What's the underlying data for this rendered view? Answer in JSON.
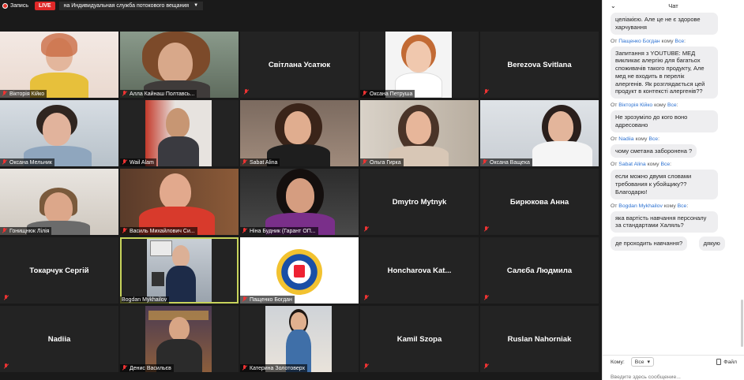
{
  "topbar": {
    "record_label": "Запись",
    "live_label": "LIVE",
    "live_target": "на Индивидуальная служба потокового вещания"
  },
  "tiles": {
    "t1": "Вікторія Кійко",
    "t2": "Алла Кайнаш Полтавсь...",
    "t3": "Світлана Усатюк",
    "t4": "Оксана Петруша",
    "t5": "Berezova Svitlana",
    "t6": "Оксана Мельник",
    "t7": "Wail Alam",
    "t8": "Sabat Alina",
    "t9": "Ольга Гирка",
    "t10": "Оксана Ващека",
    "t11": "Гонищнюк Лілія",
    "t12": "Василь Михайлович Си...",
    "t13": "Ніна Будник (Гарант ОП...",
    "t14": "Dmytro Mytnyk",
    "t15": "Бирюкова Анна",
    "t16": "Токарчук Сергій",
    "t17": "Bogdan Mykhailov",
    "t18": "Пащенко Богдан",
    "t19": "Honcharova  Kat...",
    "t20": "Салєба Людмила",
    "t21": "Nadiia",
    "t22": "Денис Васильєв",
    "t23": "Катерина Золотоверх",
    "t24": "Kamil Szopa",
    "t25": "Ruslan Nahorniak"
  },
  "chat": {
    "title": "Чат",
    "from_word": "От",
    "to_word": "кому",
    "first_bubble": "целіакією. Але це не є здорове харчування",
    "messages": [
      {
        "from": "Пащенко Богдан",
        "to": "Все",
        "text": "Запитання з YOUTUBE: МЕД викликає алергію для багатьох споживачів такого продукту, Але мед не входить в перелік алергенів. Як розглядається цей продукт в контексті алергенів??"
      },
      {
        "from": "Вікторія Кійко",
        "to": "Все",
        "text": "Не зрозуміло до кого воно адресовано"
      },
      {
        "from": "Nadiia",
        "to": "Все",
        "text": "чому сметана заборонена ?"
      },
      {
        "from": "Sabat Alina",
        "to": "Все",
        "text": "если можно двумя словами требования к убойщику?? Благодарю!"
      },
      {
        "from": "Bogdan Mykhailov",
        "to": "Все",
        "text": "яка вартість навчання персоналу за стандартами Халяль?"
      }
    ],
    "extra_bubbles": [
      "де проходить навчання?",
      "дякую"
    ],
    "footer": {
      "to_label": "Кому:",
      "to_value": "Все",
      "file_label": "Файл",
      "placeholder": "Введите здесь сообщение..."
    }
  }
}
